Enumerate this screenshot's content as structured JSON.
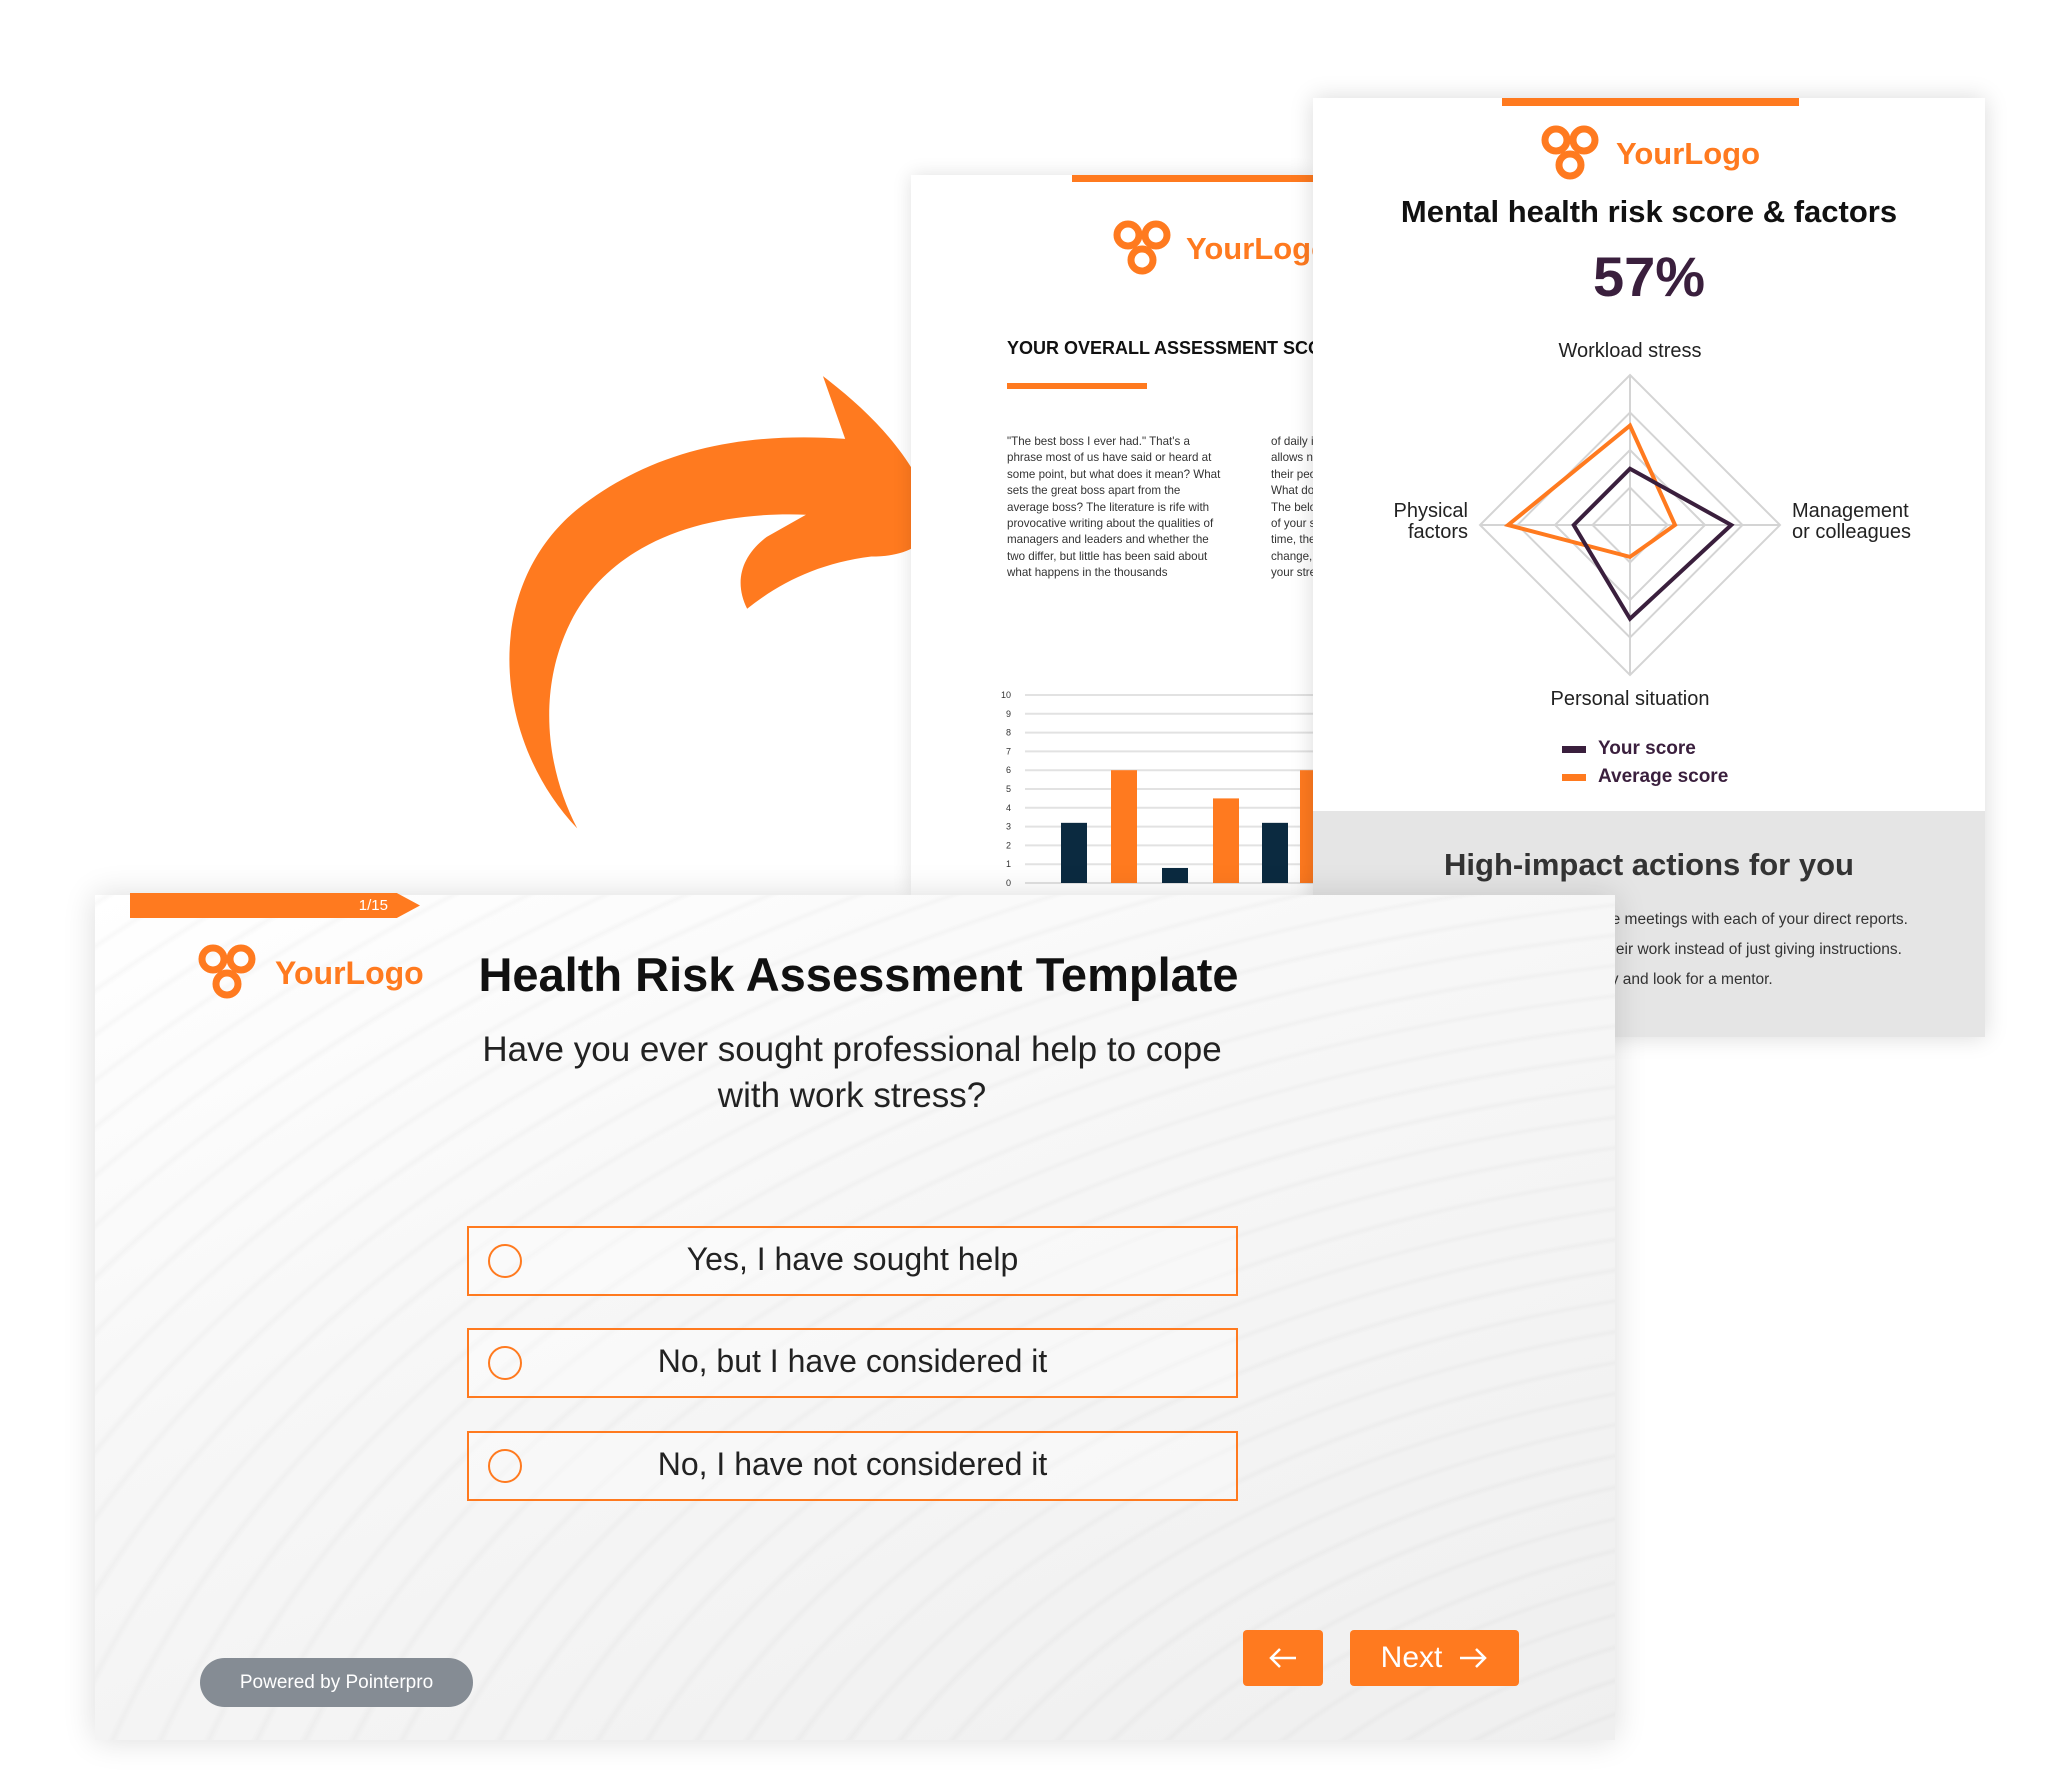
{
  "brand": {
    "logo_text": "YourLogo",
    "accent": "#ff7a1f",
    "dark": "#3a1f3d",
    "navy": "#0b2a40"
  },
  "doc": {
    "heading": "YOUR OVERALL ASSESSMENT SCOR",
    "col1": "\"The best boss I ever had.\" That's a phrase most of us have said or heard at some point, but what does it mean? What sets the great boss apart from the average boss? The literature is rife with provocative writing about the qualities of managers and leaders and whether the two differ, but little has been said about what happens in the thousands",
    "col2_lines": [
      "of daily i",
      "allows n",
      "their peo",
      "What do",
      "The belo",
      "of your s",
      "time, the",
      "change,",
      "your stre"
    ]
  },
  "report": {
    "title": "Mental health risk score & factors",
    "score": "57%",
    "legend": {
      "yours": "Your score",
      "average": "Average score"
    },
    "actions_title": "High-impact actions for you",
    "actions": [
      "ne meetings with each of your direct reports.",
      "their work instead of just giving instructions.",
      "ity and look for a mentor."
    ]
  },
  "chart_data": [
    {
      "type": "radar",
      "axes": [
        "Workload stress",
        "Management\nor colleagues",
        "Personal situation",
        "Physical\nfactors"
      ],
      "range": [
        0,
        4
      ],
      "series": [
        {
          "name": "Your score",
          "color": "#3a1f3d",
          "values": [
            1.5,
            2.7,
            2.5,
            1.5
          ]
        },
        {
          "name": "Average score",
          "color": "#ff7a1f",
          "values": [
            2.65,
            1.2,
            0.85,
            3.25
          ]
        }
      ]
    },
    {
      "type": "bar",
      "yticks": [
        "0",
        "1",
        "2",
        "3",
        "4",
        "5",
        "6",
        "7",
        "8",
        "9",
        "10"
      ],
      "ylim": [
        0,
        10
      ],
      "grid": true,
      "values": [
        3.2,
        6,
        0.8,
        4.5,
        3.2,
        6
      ],
      "colors": [
        "#0b2a40",
        "#ff7a1f",
        "#0b2a40",
        "#ff7a1f",
        "#0b2a40",
        "#ff7a1f"
      ]
    }
  ],
  "quiz": {
    "progress": "1/15",
    "progress_fraction": 0.0667,
    "title": "Health Risk Assessment Template",
    "question": "Have you ever sought professional help to cope with work stress?",
    "options": [
      "Yes, I have sought help",
      "No, but I have considered it",
      "No, I have not considered it"
    ],
    "back_icon": "arrow-left",
    "next_label": "Next",
    "next_icon": "arrow-right",
    "powered": "Powered by Pointerpro"
  }
}
